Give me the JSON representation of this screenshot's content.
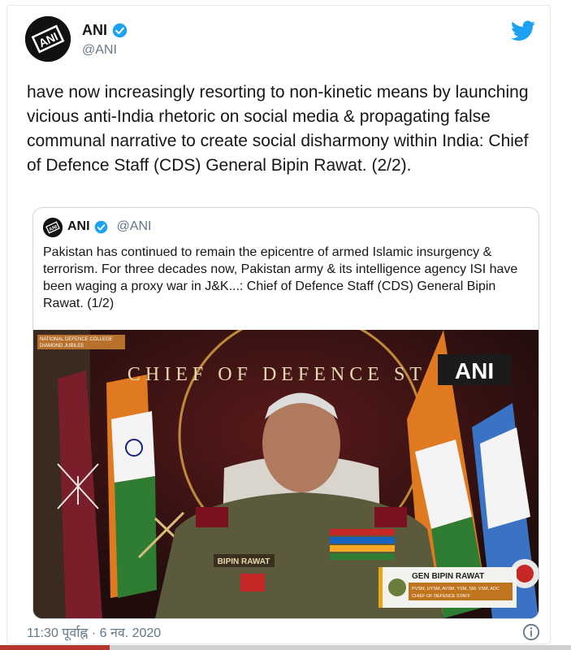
{
  "author": {
    "name": "ANI",
    "handle": "@ANI",
    "avatar_text": "ANI"
  },
  "tweet": {
    "text": "have now increasingly resorting to non-kinetic means by launching vicious anti-India rhetoric on social media & propagating false communal narrative to create social disharmony within India: Chief of Defence Staff (CDS) General Bipin Rawat. (2/2)."
  },
  "quoted_tweet": {
    "name": "ANI",
    "handle": "@ANI",
    "text": "Pakistan has continued to remain the epicentre of armed Islamic insurgency & terrorism. For three decades now, Pakistan army & its intelligence agency ISI have been waging a proxy war in J&K...: Chief of Defence Staff (CDS) General Bipin Rawat. (1/2)",
    "media": {
      "college_label_1": "NATIONAL DEFENCE COLLEGE",
      "college_label_2": "DIAMOND JUBILEE",
      "backdrop_text": "CHIEF OF DEFENCE STAFF",
      "watermark": "ANI",
      "name_tag": "BIPIN RAWAT",
      "lower_third_name": "GEN BIPIN RAWAT",
      "lower_third_line1": "PVSM, UYSM, AVSM, YSM, SM, VSM, ADC",
      "lower_third_line2": "CHIEF OF DEFENCE STAFF"
    }
  },
  "footer": {
    "timestamp": "11:30 पूर्वाह्न · 6 नव. 2020"
  },
  "colors": {
    "twitter_blue": "#1da1f2",
    "text": "#14171a",
    "secondary": "#657786"
  },
  "icons": [
    "twitter-bird-icon",
    "verified-badge-icon",
    "info-icon"
  ]
}
